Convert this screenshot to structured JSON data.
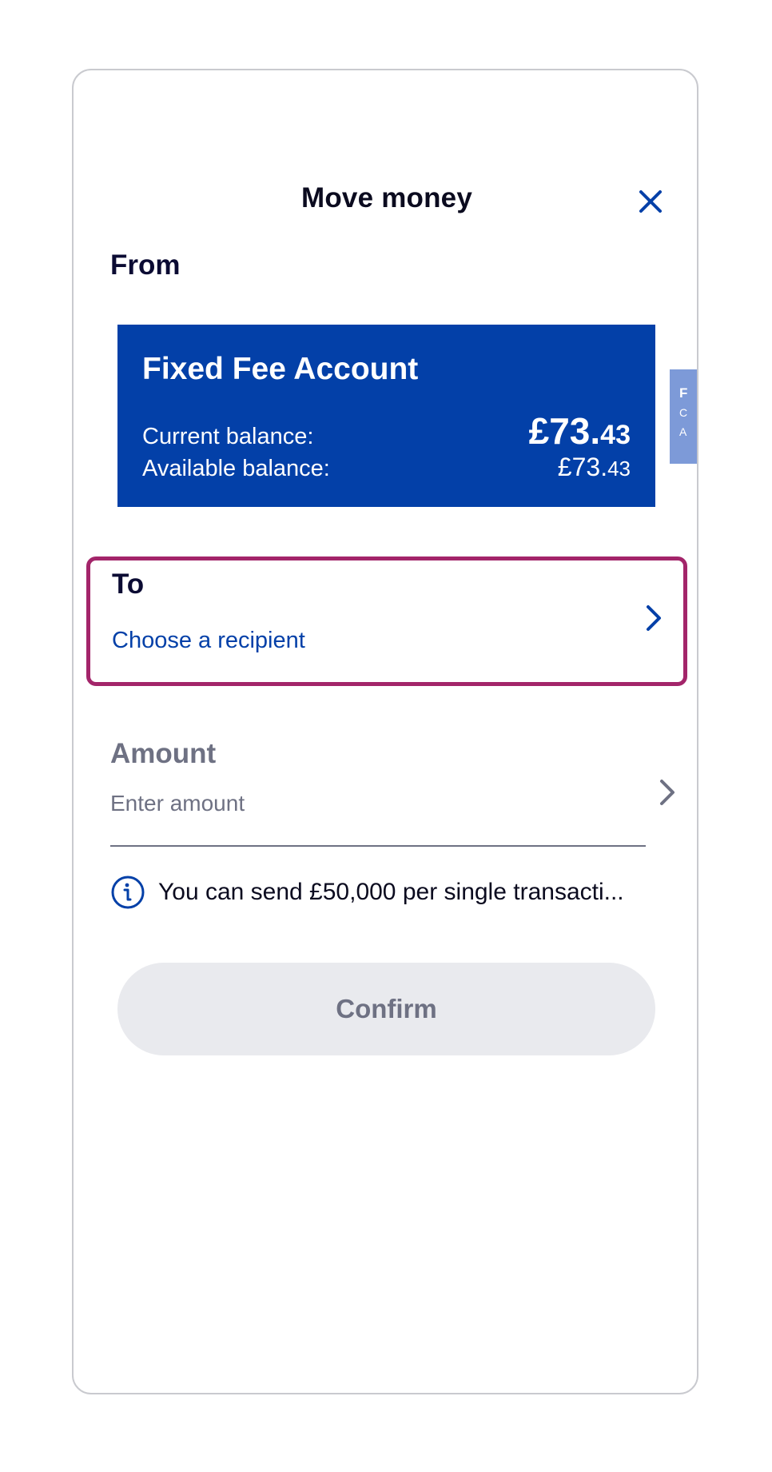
{
  "header": {
    "title": "Move money",
    "close_icon": "close-icon"
  },
  "from": {
    "label": "From",
    "account": {
      "name": "Fixed Fee Account",
      "current_balance_label": "Current balance:",
      "current_balance_pounds": "£73.",
      "current_balance_pence": "43",
      "available_balance_label": "Available balance:",
      "available_balance_pounds": "£73.",
      "available_balance_pence": "43"
    },
    "next_card_peek": {
      "initial": "F",
      "line1": "C",
      "line2": "A"
    }
  },
  "to": {
    "label": "To",
    "value": "Choose a recipient"
  },
  "amount": {
    "label": "Amount",
    "placeholder": "Enter amount"
  },
  "info": {
    "icon": "info-icon",
    "text": "You can send £50,000 per single transacti..."
  },
  "actions": {
    "confirm_label": "Confirm"
  },
  "colors": {
    "brand_blue": "#0340a8",
    "highlight_border": "#a3256a",
    "muted_text": "#6e7183",
    "disabled_button_bg": "#e9eaee"
  }
}
